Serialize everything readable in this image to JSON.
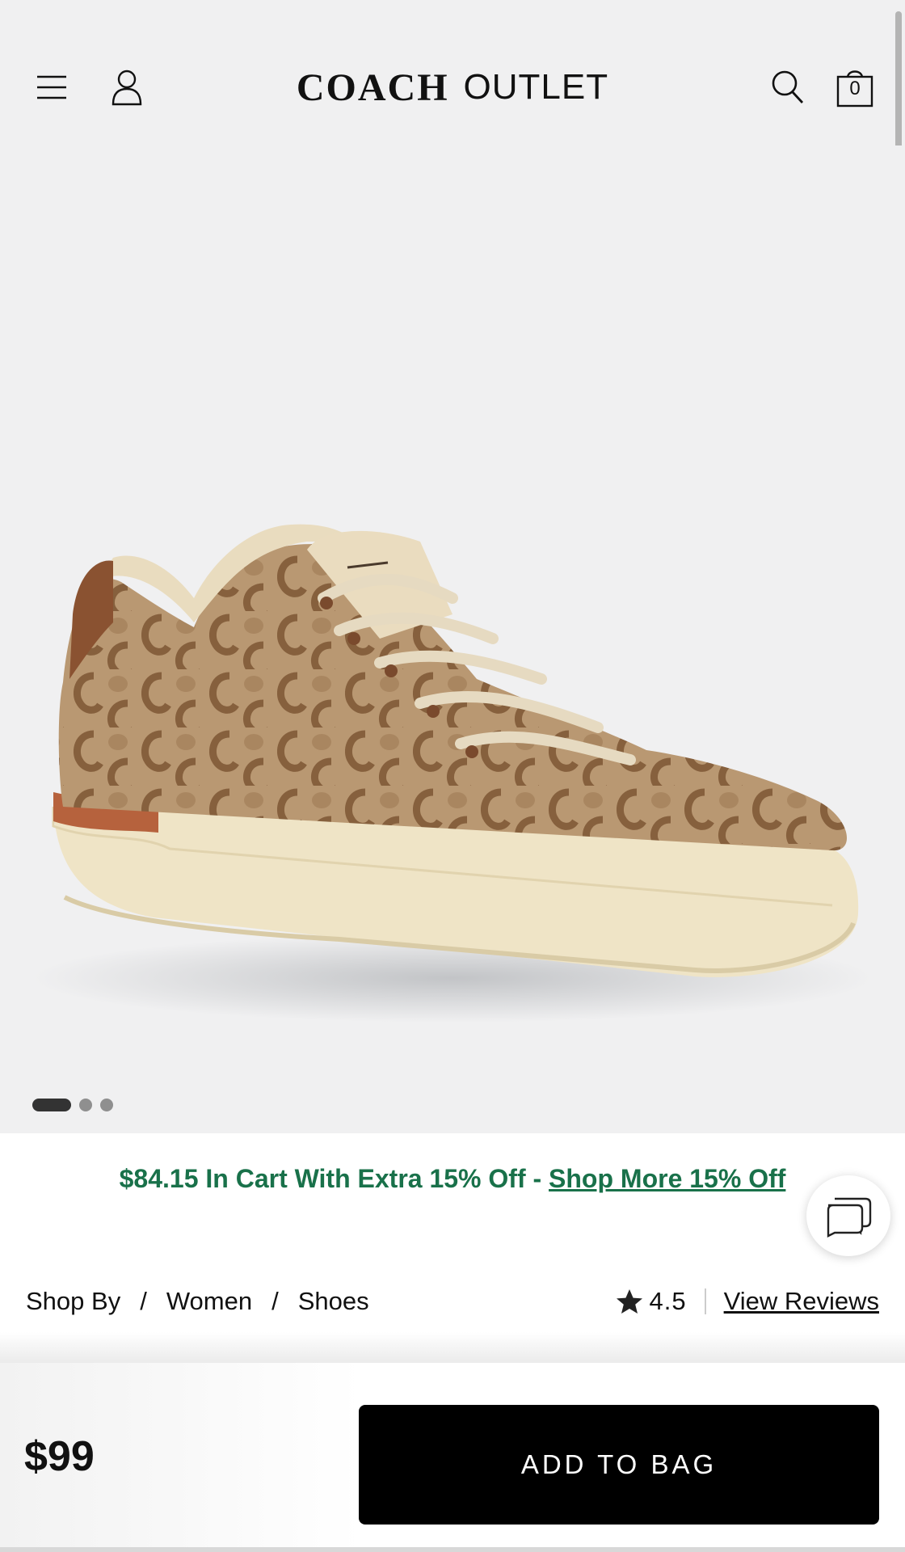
{
  "header": {
    "logo_brand": "COACH",
    "logo_sub": "OUTLET",
    "bag_count": "0",
    "icons": {
      "menu": "hamburger-menu-icon",
      "account": "user-icon",
      "search": "search-icon",
      "bag": "shopping-bag-icon"
    }
  },
  "hero": {
    "image": "tan signature jacquard low-top sneaker with cream sole",
    "carousel": {
      "total": 3,
      "active": 1
    }
  },
  "promo": {
    "text": "$84.15 In Cart With Extra 15% Off - ",
    "link": "Shop More 15% Off",
    "color": "#19714a"
  },
  "breadcrumb": {
    "items": [
      "Shop By",
      "Women",
      "Shoes"
    ],
    "separator": "/"
  },
  "rating": {
    "value": "4.5",
    "reviews_link": "View Reviews"
  },
  "purchase": {
    "price": "$99",
    "add_to_bag": "ADD TO BAG"
  },
  "colors": {
    "background": "#f0f0f1",
    "button": "#000000",
    "promo_green": "#19714a"
  }
}
